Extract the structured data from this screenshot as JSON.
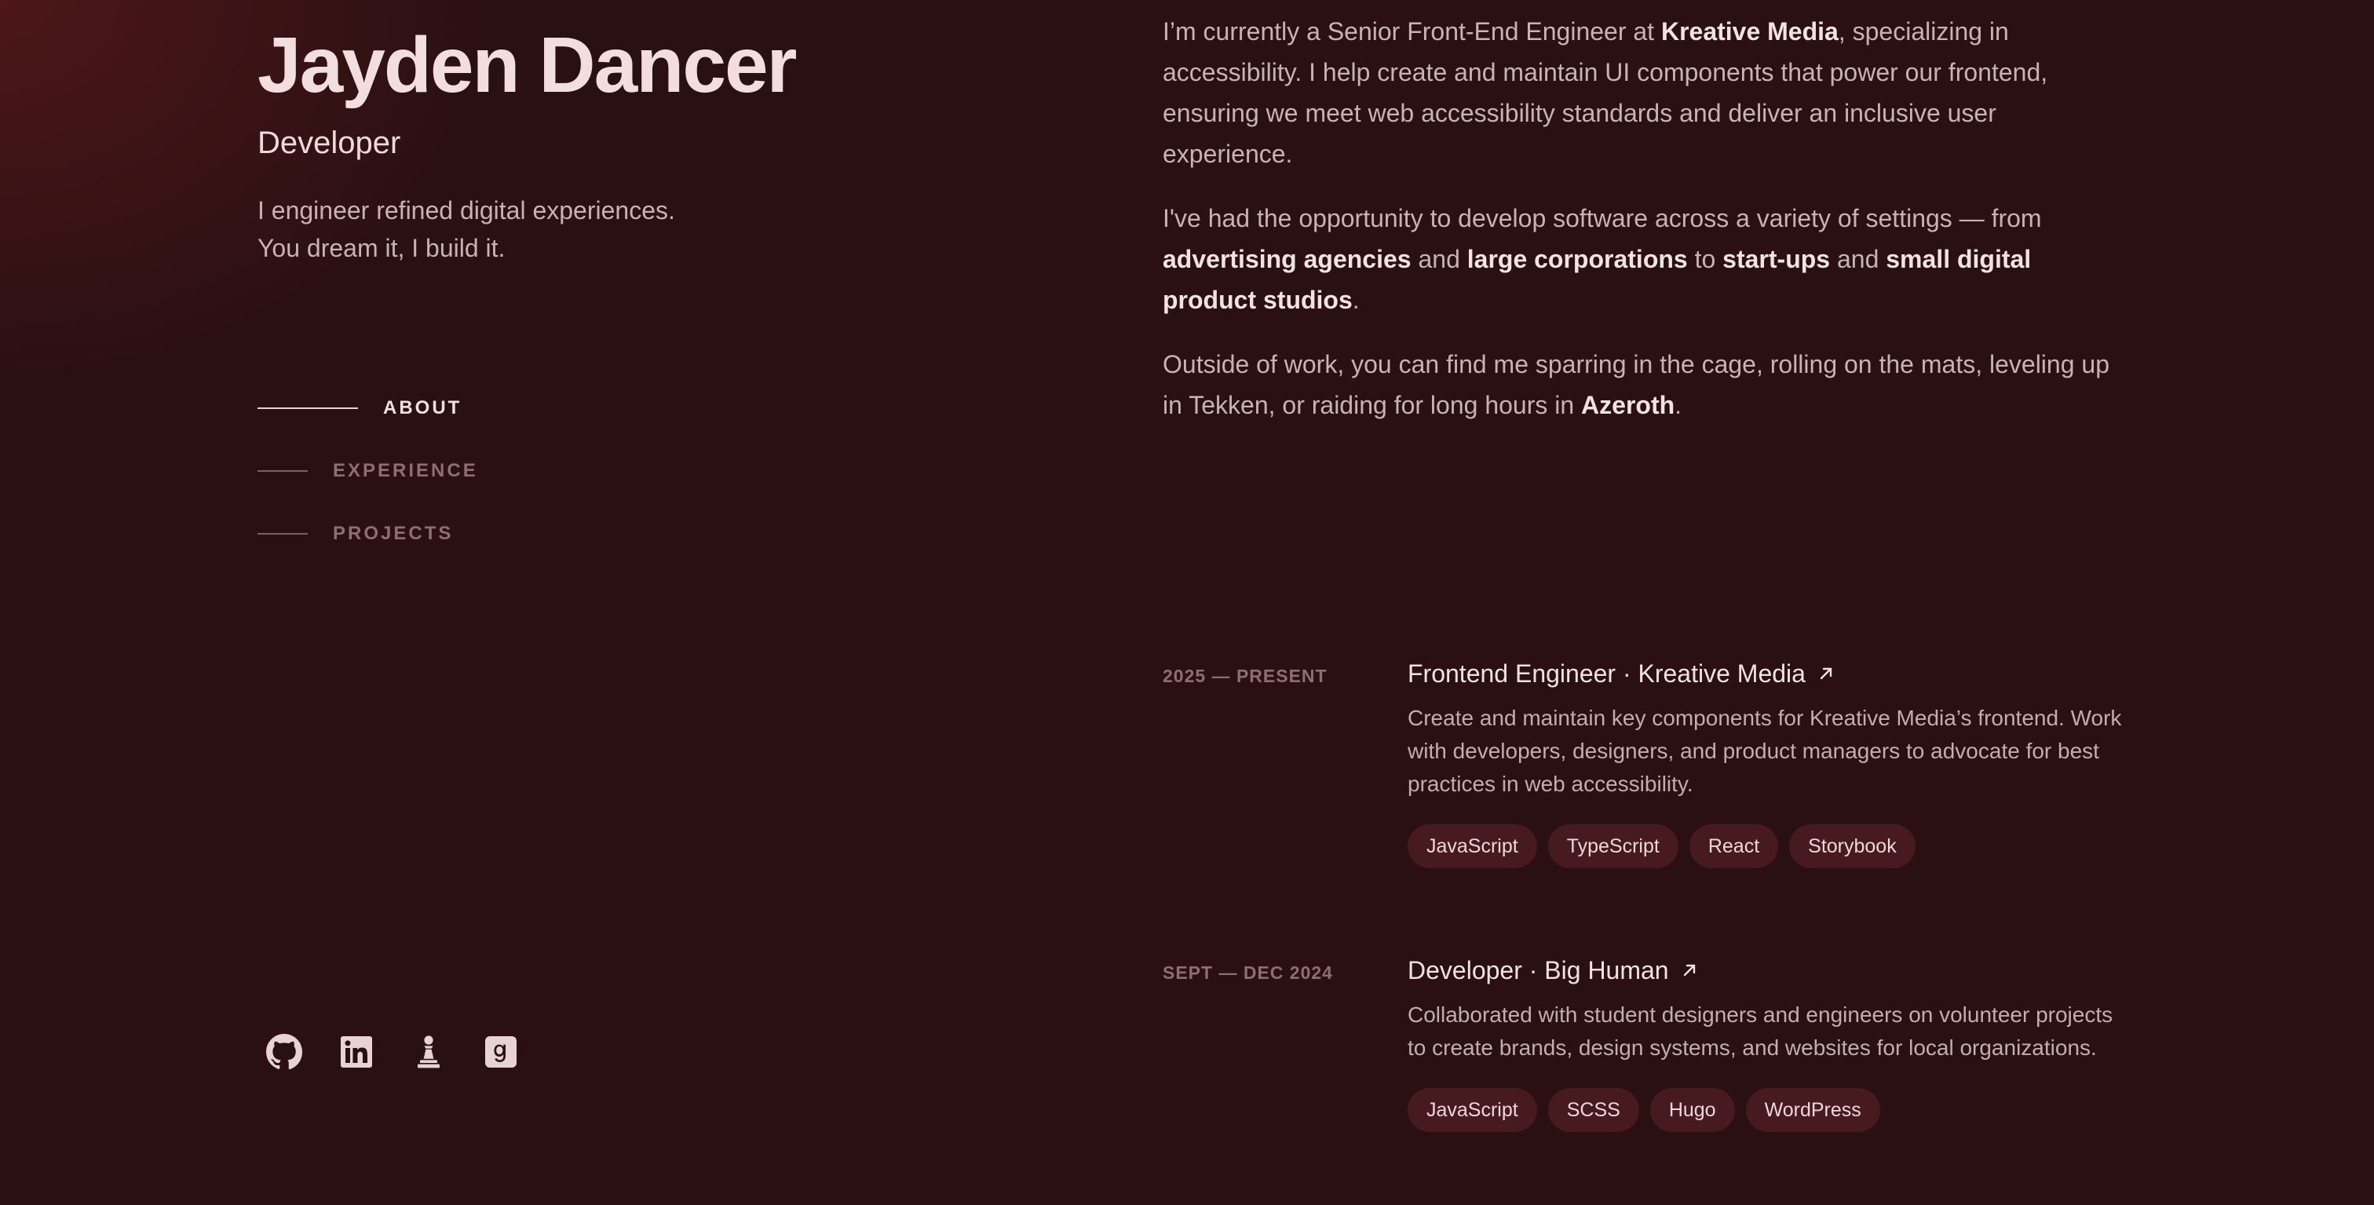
{
  "profile": {
    "name": "Jayden Dancer",
    "role": "Developer",
    "tagline_line1": "I engineer refined digital experiences.",
    "tagline_line2": "You dream it, I build it."
  },
  "nav": {
    "items": [
      {
        "label": "ABOUT",
        "active": true
      },
      {
        "label": "EXPERIENCE",
        "active": false
      },
      {
        "label": "PROJECTS",
        "active": false
      }
    ]
  },
  "socials": [
    {
      "icon": "github-icon"
    },
    {
      "icon": "linkedin-icon"
    },
    {
      "icon": "chess-pawn-icon"
    },
    {
      "icon": "goodreads-icon"
    }
  ],
  "about": {
    "p1": {
      "t1": "I’m currently a Senior Front-End Engineer at ",
      "b1": "Kreative Media",
      "t2": ", specializing in accessibility. I help create and maintain UI components that power our frontend, ensuring we meet web accessibility standards and deliver an inclusive user experience."
    },
    "p2": {
      "t1": "I've had the opportunity to develop software across a variety of settings — from ",
      "b1": "advertising agencies",
      "t2": " and ",
      "b2": "large corporations",
      "t3": " to ",
      "b3": "start-ups",
      "t4": " and ",
      "b4": "small digital product studios",
      "t5": "."
    },
    "p3": {
      "t1": "Outside of work, you can find me sparring in the cage, rolling on the mats, leveling up in Tekken, or raiding for long hours in ",
      "b1": "Azeroth",
      "t2": "."
    }
  },
  "experience": [
    {
      "date": "2025 — PRESENT",
      "title": "Frontend Engineer · Kreative Media",
      "description": "Create and maintain key components for Kreative Media’s frontend. Work with developers, designers, and product managers to advocate for best practices in web accessibility.",
      "tags": [
        "JavaScript",
        "TypeScript",
        "React",
        "Storybook"
      ]
    },
    {
      "date": "SEPT — DEC 2024",
      "title": "Developer · Big Human",
      "description": "Collaborated with student designers and engineers on volunteer projects to create brands, design systems, and websites for local organizations.",
      "tags": [
        "JavaScript",
        "SCSS",
        "Hugo",
        "WordPress"
      ]
    }
  ],
  "colors": {
    "background": "#2a1013",
    "accent_glow": "#781e1e",
    "tag_bg": "#461a1e",
    "heading": "#f2dede"
  }
}
